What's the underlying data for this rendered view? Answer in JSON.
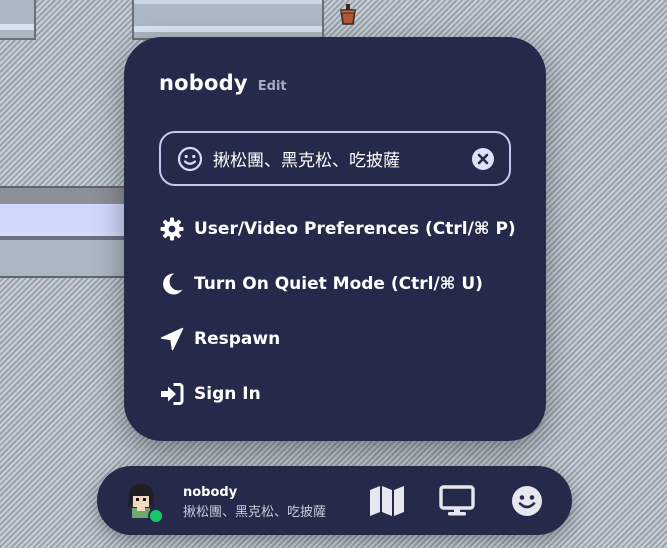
{
  "menu": {
    "username": "nobody",
    "edit_label": "Edit",
    "status_value": "揪松團、黑克松、吃披薩",
    "items": [
      {
        "label": "User/Video Preferences (Ctrl/⌘ P)",
        "icon": "gear-icon"
      },
      {
        "label": "Turn On Quiet Mode (Ctrl/⌘ U)",
        "icon": "moon-icon"
      },
      {
        "label": "Respawn",
        "icon": "location-arrow-icon"
      },
      {
        "label": "Sign In",
        "icon": "sign-in-icon"
      }
    ]
  },
  "bottom_bar": {
    "name": "nobody",
    "status": "揪松團、黑克松、吃披薩",
    "online_color": "#16c86a",
    "buttons": [
      "map-icon",
      "screen-share-icon",
      "emoji-icon"
    ]
  },
  "colors": {
    "panel": "#252a4a",
    "accent_border": "#c3c7f2",
    "muted_text": "#a6aabd"
  }
}
